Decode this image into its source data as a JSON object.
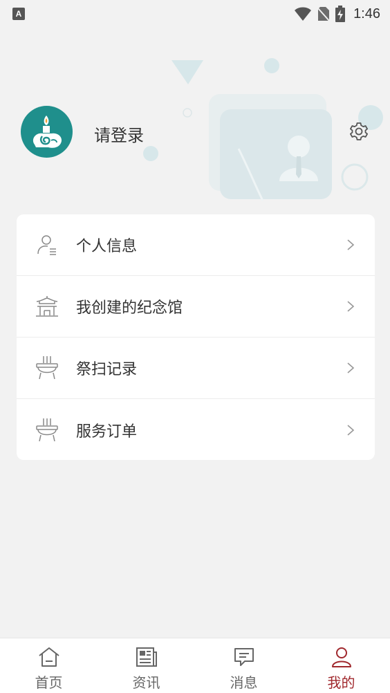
{
  "status_bar": {
    "notification_icon": "A",
    "time": "1:46",
    "icons": [
      "wifi-icon",
      "no-sim-icon",
      "battery-charging-icon"
    ]
  },
  "profile": {
    "login_label": "请登录",
    "avatar_icon": "incense-logo-icon",
    "settings_icon": "gear-icon"
  },
  "menu": {
    "items": [
      {
        "label": "个人信息",
        "icon": "person-info-icon"
      },
      {
        "label": "我创建的纪念馆",
        "icon": "memorial-hall-icon"
      },
      {
        "label": "祭扫记录",
        "icon": "incense-burner-icon"
      },
      {
        "label": "服务订单",
        "icon": "incense-burner-icon"
      }
    ]
  },
  "tabs": [
    {
      "label": "首页",
      "icon": "home-icon",
      "active": false
    },
    {
      "label": "资讯",
      "icon": "news-icon",
      "active": false
    },
    {
      "label": "消息",
      "icon": "message-icon",
      "active": false
    },
    {
      "label": "我的",
      "icon": "user-icon",
      "active": true
    }
  ],
  "colors": {
    "accent": "#a0282d",
    "avatar_bg": "#1f8f8c",
    "background": "#f2f2f2"
  }
}
